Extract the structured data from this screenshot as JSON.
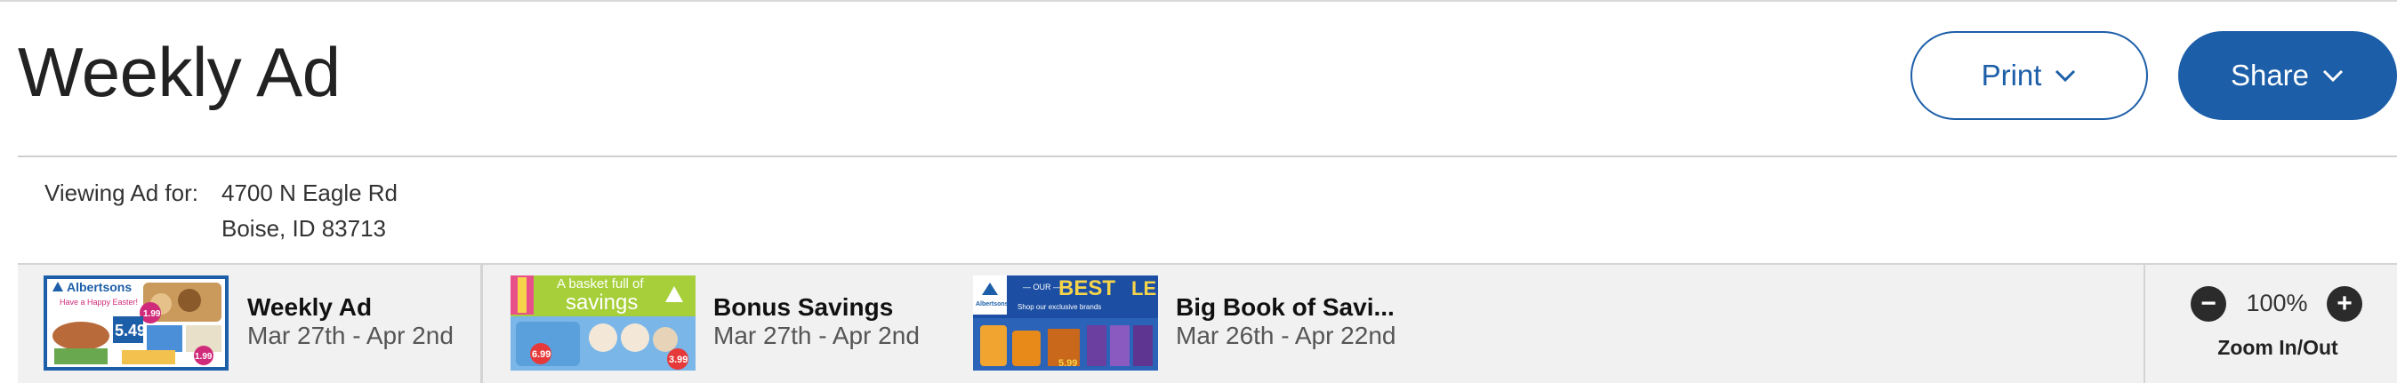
{
  "page_title": "Weekly Ad",
  "actions": {
    "print_label": "Print",
    "share_label": "Share",
    "accent_color": "#1c5ea8"
  },
  "location": {
    "label": "Viewing Ad for:",
    "address_line1": "4700 N Eagle Rd",
    "address_line2": "Boise, ID 83713"
  },
  "ads": [
    {
      "name": "Weekly Ad",
      "dates": "Mar 27th - Apr 2nd",
      "thumb_brand": "Albertsons",
      "thumb_tagline": "Have a Happy Easter!",
      "thumb_prices": [
        "1.99",
        "5.49",
        "1.99"
      ],
      "selected": true
    },
    {
      "name": "Bonus Savings",
      "dates": "Mar 27th - Apr 2nd",
      "thumb_tagline_1": "A basket full of",
      "thumb_tagline_2": "savings",
      "thumb_prices": [
        "6.99",
        "3.99"
      ]
    },
    {
      "name": "Big Book of Savi...",
      "dates": "Mar 26th - Apr 22nd",
      "thumb_brand": "Albertsons",
      "thumb_headline_1": "— OUR —",
      "thumb_headline_2": "BEST",
      "thumb_headline_3": "LE",
      "thumb_subline": "Shop our exclusive brands",
      "thumb_prices": [
        "5.99"
      ]
    }
  ],
  "zoom": {
    "value": "100%",
    "label": "Zoom In/Out",
    "minus_symbol": "−",
    "plus_symbol": "+"
  }
}
